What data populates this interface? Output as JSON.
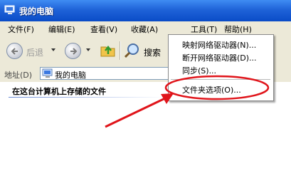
{
  "window": {
    "title": "我的电脑"
  },
  "menubar": {
    "items": [
      "文件(F)",
      "编辑(E)",
      "查看(V)",
      "收藏(A)",
      "工具(T)",
      "帮助(H)"
    ]
  },
  "toolbar": {
    "back_label": "后退",
    "search_label": "搜索"
  },
  "addressbar": {
    "label": "地址(D)",
    "value": "我的电脑"
  },
  "content": {
    "section_heading": "在这台计算机上存储的文件"
  },
  "tools_menu": {
    "items": [
      "映射网络驱动器(N)...",
      "断开网络驱动器(D)...",
      "同步(S)...",
      "文件夹选项(O)..."
    ]
  },
  "colors": {
    "titlebar": "#0a4cc7",
    "annotation": "#e0141a",
    "menubar": "#ece9d8"
  }
}
